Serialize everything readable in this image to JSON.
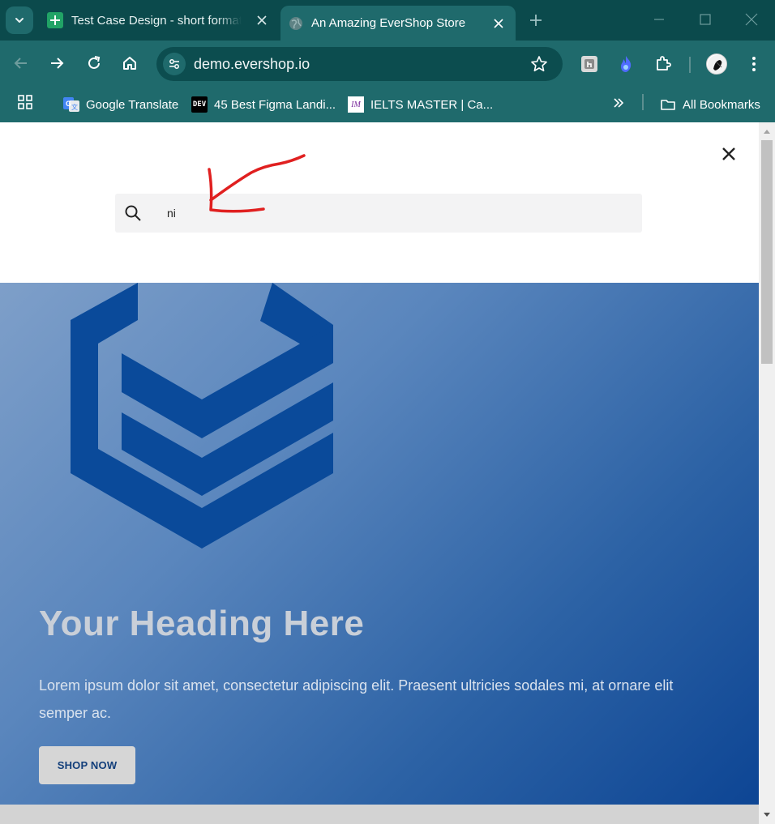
{
  "browser": {
    "tabs": [
      {
        "title": "Test Case Design - short format",
        "favicon": "sheets-icon",
        "active": false
      },
      {
        "title": "An Amazing EverShop Store",
        "favicon": "globe-icon",
        "active": true
      }
    ],
    "url": "demo.evershop.io",
    "bookmarks": [
      {
        "label": "Google Translate",
        "icon": "google-translate-icon"
      },
      {
        "label": "45 Best Figma Landi...",
        "icon": "dev-icon",
        "badge": "DEV"
      },
      {
        "label": "IELTS MASTER | Ca...",
        "icon": "ielts-master-icon",
        "badge": "IM"
      }
    ],
    "all_bookmarks_label": "All Bookmarks",
    "colors": {
      "frame": "#0b4a4c",
      "toolbar": "#1f6a6c"
    }
  },
  "search": {
    "value": "ni",
    "annotation": "red-arrow-annotation"
  },
  "hero": {
    "heading": "Your Heading Here",
    "text": "Lorem ipsum dolor sit amet, consectetur adipiscing elit. Praesent ultricies sodales mi, at ornare elit semper ac.",
    "button_label": "SHOP NOW",
    "logo": "evershop-logo",
    "colors": {
      "logo": "#0a4a9a",
      "gradient_start": "#7e9fc9",
      "gradient_end": "#0d4594"
    }
  }
}
